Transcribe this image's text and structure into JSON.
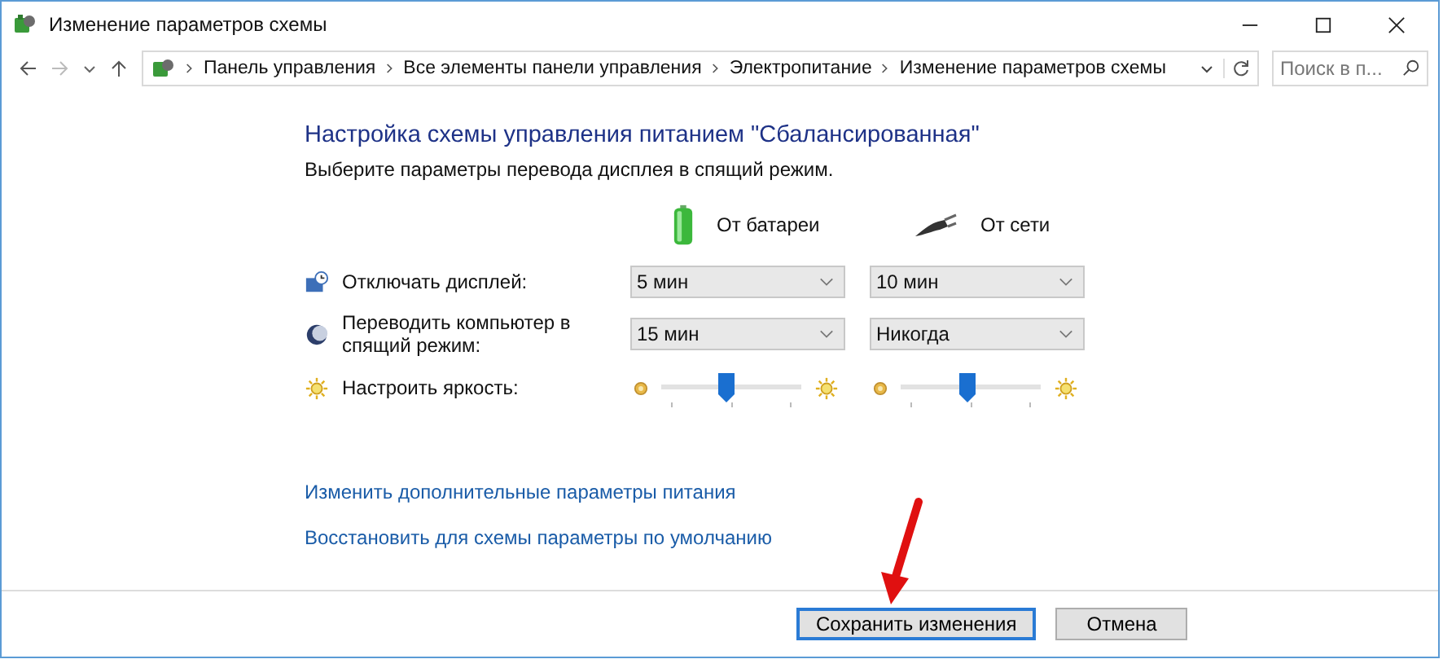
{
  "window": {
    "title": "Изменение параметров схемы"
  },
  "address_bar": {
    "path": [
      "Панель управления",
      "Все элементы панели управления",
      "Электропитание",
      "Изменение параметров схемы"
    ],
    "search_placeholder": "Поиск в п..."
  },
  "plan": {
    "heading": "Настройка схемы управления питанием \"Сбалансированная\"",
    "subtitle": "Выберите параметры перевода дисплея в спящий режим.",
    "columns": [
      {
        "kind": "battery",
        "label": "От батареи"
      },
      {
        "kind": "plug",
        "label": "От сети"
      }
    ],
    "settings": [
      {
        "kind": "dropdown",
        "label": "Отключать дисплей:",
        "values": [
          "5 мин",
          "10 мин"
        ]
      },
      {
        "kind": "dropdown",
        "label": "Переводить компьютер в спящий режим:",
        "values": [
          "15 мин",
          "Никогда"
        ]
      },
      {
        "kind": "slider",
        "label": "Настроить яркость:",
        "levels": [
          {
            "level": 0.46
          },
          {
            "level": 0.48
          }
        ]
      }
    ]
  },
  "links": [
    "Изменить дополнительные параметры питания",
    "Восстановить для схемы параметры по умолчанию"
  ],
  "buttons": [
    {
      "label": "Сохранить изменения",
      "default": true
    },
    {
      "label": "Отмена",
      "default": false
    }
  ]
}
